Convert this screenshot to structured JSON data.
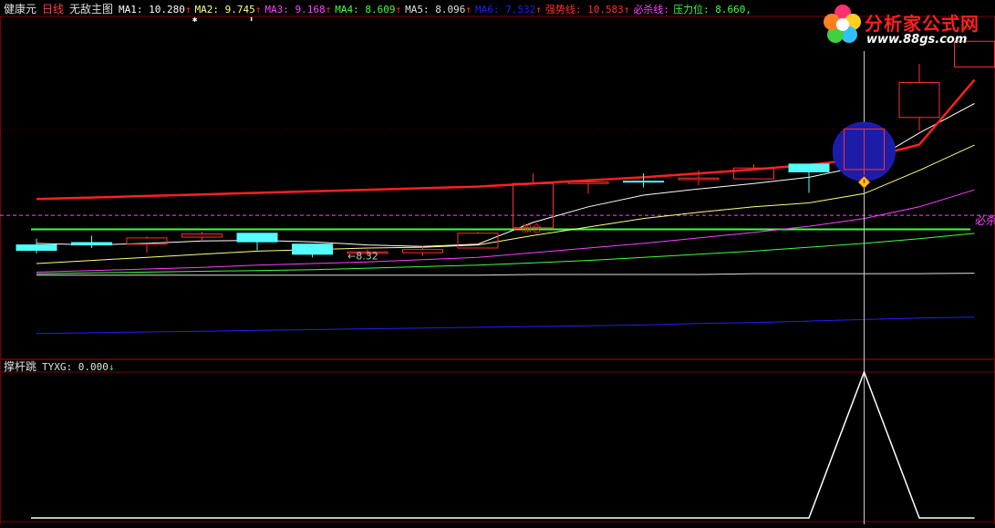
{
  "header": {
    "stock_name": "健康元",
    "period": "日线",
    "indicator_name": "无敌主图",
    "items": [
      {
        "text": "MA1: 10.280",
        "arrow": "↑",
        "color": "#ffffff"
      },
      {
        "text": "MA2: 9.745",
        "arrow": "↑",
        "color": "#ffff80"
      },
      {
        "text": "MA3: 9.168",
        "arrow": "↑",
        "color": "#ff40ff"
      },
      {
        "text": "MA4: 8.609",
        "arrow": "↑",
        "color": "#40ff40"
      },
      {
        "text": "MA5: 8.096",
        "arrow": "↑",
        "color": "#e0e0e0"
      },
      {
        "text": "MA6: 7.532",
        "arrow": "↑",
        "color": "#2020ff"
      },
      {
        "text": "强势线: 10.583",
        "arrow": "↑",
        "color": "#ff3030"
      },
      {
        "text": "必杀线: ",
        "arrow": "",
        "color": "#ff40ff"
      },
      {
        "text": "压力位: 8.660,",
        "arrow": "",
        "color": "#40ff40"
      }
    ]
  },
  "lower_header": {
    "name": "撑杆跳",
    "value_text": "TYXG: 0.000",
    "arrow": "↓"
  },
  "logo": {
    "cn": "分析家公式网",
    "url": "www.88gs.com"
  },
  "chart_data": [
    {
      "type": "candlestick",
      "title": "健康元 日线 无敌主图",
      "candles": [
        {
          "o": 8.46,
          "h": 8.54,
          "l": 8.35,
          "c": 8.39
        },
        {
          "o": 8.49,
          "h": 8.58,
          "l": 8.42,
          "c": 8.46
        },
        {
          "o": 8.47,
          "h": 8.57,
          "l": 8.36,
          "c": 8.55
        },
        {
          "o": 8.56,
          "h": 8.63,
          "l": 8.51,
          "c": 8.6
        },
        {
          "o": 8.61,
          "h": 8.61,
          "l": 8.39,
          "c": 8.5
        },
        {
          "o": 8.47,
          "h": 8.47,
          "l": 8.3,
          "c": 8.34
        },
        {
          "o": 8.35,
          "h": 8.4,
          "l": 8.32,
          "c": 8.37
        },
        {
          "o": 8.36,
          "h": 8.44,
          "l": 8.32,
          "c": 8.4
        },
        {
          "o": 8.42,
          "h": 8.63,
          "l": 8.42,
          "c": 8.61
        },
        {
          "o": 8.68,
          "h": 9.38,
          "l": 8.68,
          "c": 9.25
        },
        {
          "o": 9.25,
          "h": 9.3,
          "l": 9.12,
          "c": 9.27
        },
        {
          "o": 9.28,
          "h": 9.38,
          "l": 9.2,
          "c": 9.27
        },
        {
          "o": 9.3,
          "h": 9.42,
          "l": 9.23,
          "c": 9.32
        },
        {
          "o": 9.31,
          "h": 9.5,
          "l": 9.3,
          "c": 9.45
        },
        {
          "o": 9.5,
          "h": 9.5,
          "l": 9.13,
          "c": 9.4
        },
        {
          "o": 9.43,
          "h": 9.96,
          "l": 9.36,
          "c": 9.95
        },
        {
          "o": 10.1,
          "h": 10.79,
          "l": 9.93,
          "c": 10.55
        },
        {
          "o": 10.75,
          "h": 11.08,
          "l": 10.75,
          "c": 11.08
        }
      ],
      "series": [
        {
          "name": "MA1",
          "color": "#ffffff",
          "values": [
            8.48,
            8.46,
            8.48,
            8.51,
            8.52,
            8.5,
            8.46,
            8.44,
            8.47,
            8.75,
            8.95,
            9.1,
            9.18,
            9.25,
            9.33,
            9.48,
            9.9,
            10.28
          ]
        },
        {
          "name": "MA2",
          "color": "#ffff80",
          "values": [
            8.22,
            8.26,
            8.3,
            8.34,
            8.38,
            8.4,
            8.42,
            8.43,
            8.46,
            8.58,
            8.69,
            8.8,
            8.88,
            8.95,
            9.0,
            9.12,
            9.42,
            9.745
          ]
        },
        {
          "name": "MA3",
          "color": "#ff40ff",
          "values": [
            8.11,
            8.13,
            8.15,
            8.17,
            8.2,
            8.22,
            8.24,
            8.27,
            8.3,
            8.36,
            8.42,
            8.48,
            8.55,
            8.62,
            8.7,
            8.8,
            8.95,
            9.168
          ]
        },
        {
          "name": "MA4",
          "color": "#40ff40",
          "values": [
            8.09,
            8.1,
            8.11,
            8.12,
            8.13,
            8.14,
            8.16,
            8.18,
            8.2,
            8.23,
            8.26,
            8.3,
            8.34,
            8.38,
            8.43,
            8.48,
            8.54,
            8.609
          ]
        },
        {
          "name": "MA5",
          "color": "#e0e0e0",
          "values": [
            8.07,
            8.07,
            8.07,
            8.07,
            8.07,
            8.07,
            8.07,
            8.07,
            8.07,
            8.08,
            8.08,
            8.08,
            8.08,
            8.09,
            8.09,
            8.09,
            8.09,
            8.096
          ]
        },
        {
          "name": "MA6",
          "color": "#2020ff",
          "values": [
            7.32,
            7.33,
            7.34,
            7.35,
            7.36,
            7.37,
            7.38,
            7.39,
            7.4,
            7.41,
            7.42,
            7.43,
            7.45,
            7.46,
            7.48,
            7.5,
            7.52,
            7.532
          ]
        },
        {
          "name": "强势线",
          "color": "#ff2020",
          "values": [
            9.05,
            9.07,
            9.09,
            9.11,
            9.13,
            9.15,
            9.17,
            9.19,
            9.21,
            9.25,
            9.29,
            9.33,
            9.38,
            9.43,
            9.49,
            9.57,
            9.75,
            10.583
          ]
        }
      ],
      "horizontal_lines": [
        {
          "name": "压力位",
          "value": 8.66,
          "color": "#40ff40"
        },
        {
          "name": "必杀线",
          "value": 8.84,
          "color": "#ff40ff",
          "dashed": true,
          "label": "必杀"
        }
      ],
      "annotations": [
        {
          "text": "←8.32",
          "candle": 6,
          "value": 8.32,
          "color": "#c0c0c0"
        },
        {
          "text": "←加仓",
          "candle": 9,
          "value": 8.68,
          "color": "#ff2020"
        }
      ],
      "marker_candle": 15,
      "ylim": [
        7.0,
        11.4
      ]
    },
    {
      "type": "line",
      "name": "TYXG",
      "values": [
        0,
        0,
        0,
        0,
        0,
        0,
        0,
        0,
        0,
        0,
        0,
        0,
        0,
        0,
        0,
        1,
        0,
        0
      ],
      "ylim": [
        0,
        1
      ]
    }
  ]
}
